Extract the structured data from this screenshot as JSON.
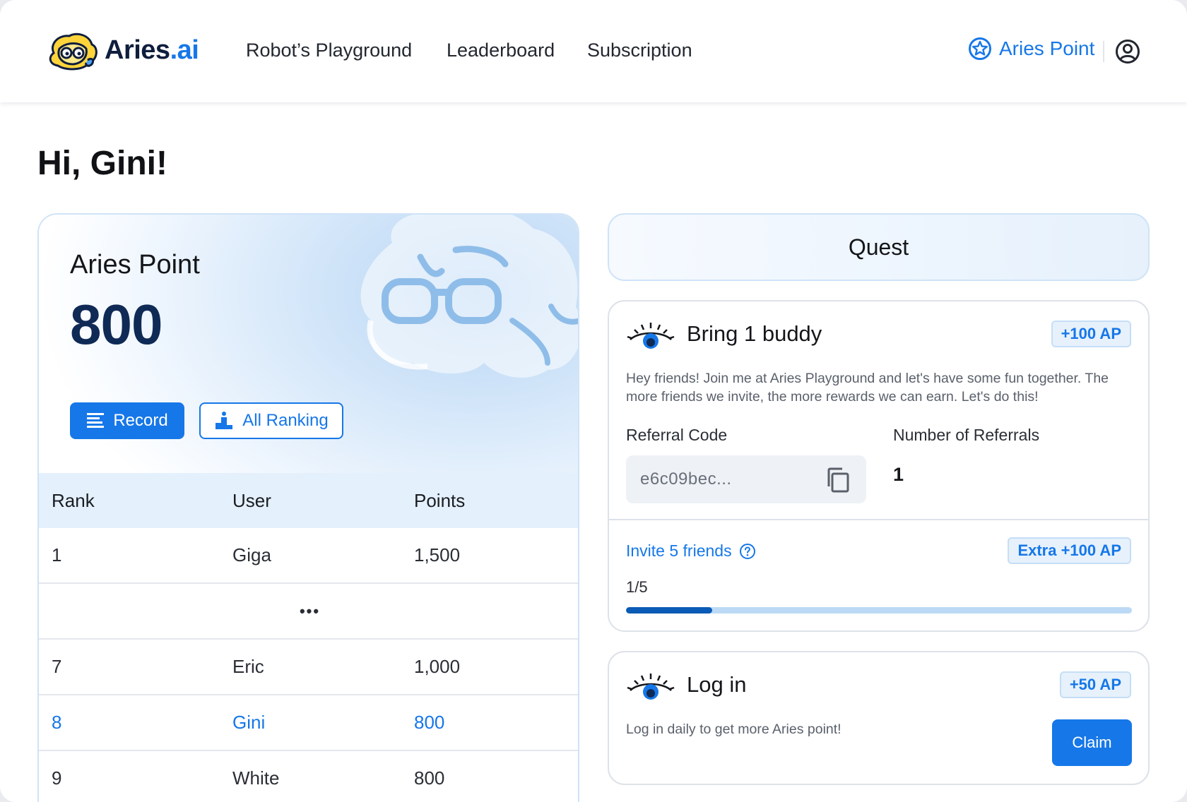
{
  "header": {
    "brand_name": "Aries",
    "brand_suffix": ".ai",
    "nav": [
      "Robot’s Playground",
      "Leaderboard",
      "Subscription"
    ],
    "points_link": "Aries Point",
    "icons": {
      "logo": "mascot-logo",
      "points": "star-badge-icon",
      "user": "user-icon"
    }
  },
  "greeting": "Hi, Gini!",
  "points_card": {
    "title": "Aries Point",
    "value": "800",
    "record_button": "Record",
    "ranking_button": "All Ranking",
    "table": {
      "columns": [
        "Rank",
        "User",
        "Points"
      ],
      "rows": [
        {
          "rank": "1",
          "user": "Giga",
          "points": "1,500"
        },
        {
          "ellipsis": "•••"
        },
        {
          "rank": "7",
          "user": "Eric",
          "points": "1,000"
        },
        {
          "rank": "8",
          "user": "Gini",
          "points": "800"
        },
        {
          "rank": "9",
          "user": "White",
          "points": "800"
        }
      ]
    }
  },
  "quest": {
    "title": "Quest",
    "buddy": {
      "title": "Bring 1 buddy",
      "reward": "+100 AP",
      "description": "Hey friends! Join me at Aries Playground and let's have some fun together. The more friends we invite, the more rewards we can earn. Let's do this!",
      "referral_code_label": "Referral Code",
      "referral_code": "e6c09bec...",
      "referrals_label": "Number of Referrals",
      "referrals_count": "1",
      "invite_label": "Invite 5 friends",
      "invite_reward": "Extra +100 AP",
      "progress_text": "1/5",
      "progress_fraction": 0.17
    },
    "login": {
      "title": "Log in",
      "reward": "+50 AP",
      "description": "Log in daily to get more Aries point!",
      "claim_button": "Claim"
    }
  },
  "colors": {
    "accent": "#1677e8",
    "accent_dark": "#0a5bb5",
    "highlight_row": "#1677e8"
  }
}
